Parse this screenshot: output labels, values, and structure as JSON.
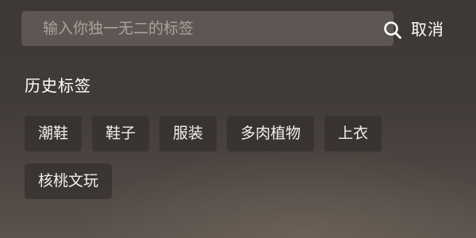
{
  "search": {
    "placeholder": "输入你独一无二的标签",
    "value": "",
    "icon": "search-icon",
    "cancel_label": "取消"
  },
  "history": {
    "title": "历史标签",
    "tags": [
      {
        "label": "潮鞋"
      },
      {
        "label": "鞋子"
      },
      {
        "label": "服装"
      },
      {
        "label": "多肉植物"
      },
      {
        "label": "上衣"
      },
      {
        "label": "核桃文玩"
      }
    ]
  },
  "colors": {
    "background": "#423c39",
    "search_field": "#6a625d",
    "tag_background": "#36312f",
    "text": "#ffffff",
    "placeholder": "#a9a29d"
  }
}
